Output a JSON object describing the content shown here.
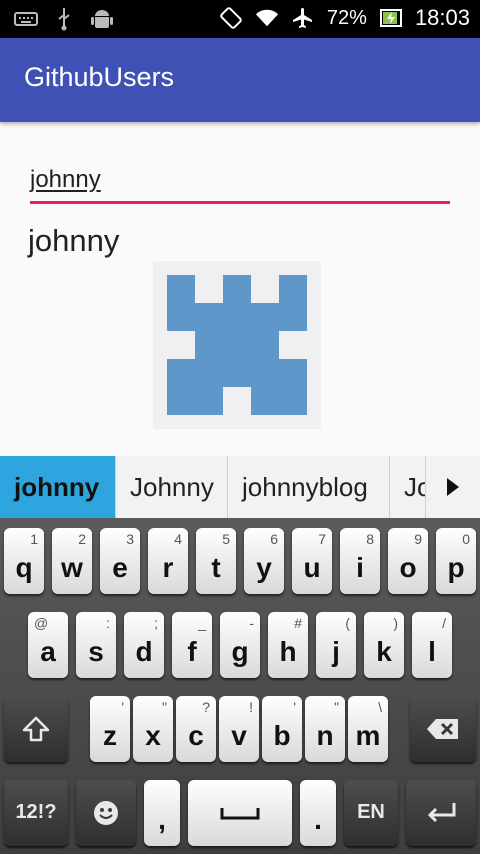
{
  "status_bar": {
    "battery_percent": "72%",
    "time": "18:03",
    "icons": [
      "keyboard-icon",
      "usb-icon",
      "android-icon",
      "rotation-icon",
      "wifi-icon",
      "airplane-icon",
      "battery-charging-icon"
    ]
  },
  "app_bar": {
    "title": "GithubUsers",
    "color": "#3f51b5"
  },
  "search": {
    "value": "johnny",
    "underline_color": "#e91e63"
  },
  "result": {
    "username": "johnny"
  },
  "suggestions": {
    "items": [
      "johnny",
      "Johnny",
      "johnnyblog",
      "Jo"
    ],
    "highlight_color": "#2ea5de"
  },
  "keyboard": {
    "row1": [
      {
        "label": "q",
        "hint": "1"
      },
      {
        "label": "w",
        "hint": "2"
      },
      {
        "label": "e",
        "hint": "3"
      },
      {
        "label": "r",
        "hint": "4"
      },
      {
        "label": "t",
        "hint": "5"
      },
      {
        "label": "y",
        "hint": "6"
      },
      {
        "label": "u",
        "hint": "7"
      },
      {
        "label": "i",
        "hint": "8"
      },
      {
        "label": "o",
        "hint": "9"
      },
      {
        "label": "p",
        "hint": "0"
      }
    ],
    "row2": [
      {
        "label": "a",
        "hint": "@"
      },
      {
        "label": "s",
        "hint": ":"
      },
      {
        "label": "d",
        "hint": ";"
      },
      {
        "label": "f",
        "hint": "_"
      },
      {
        "label": "g",
        "hint": "-"
      },
      {
        "label": "h",
        "hint": "#"
      },
      {
        "label": "j",
        "hint": "("
      },
      {
        "label": "k",
        "hint": ")"
      },
      {
        "label": "l",
        "hint": "/"
      }
    ],
    "row3": [
      {
        "label": "z",
        "hint": "'"
      },
      {
        "label": "x",
        "hint": "\""
      },
      {
        "label": "c",
        "hint": "?"
      },
      {
        "label": "v",
        "hint": "!"
      },
      {
        "label": "b",
        "hint": "'"
      },
      {
        "label": "n",
        "hint": "\""
      },
      {
        "label": "m",
        "hint": "\\"
      }
    ],
    "symbols_label": "12!?",
    "comma_label": ",",
    "period_label": ".",
    "language_label": "EN"
  }
}
